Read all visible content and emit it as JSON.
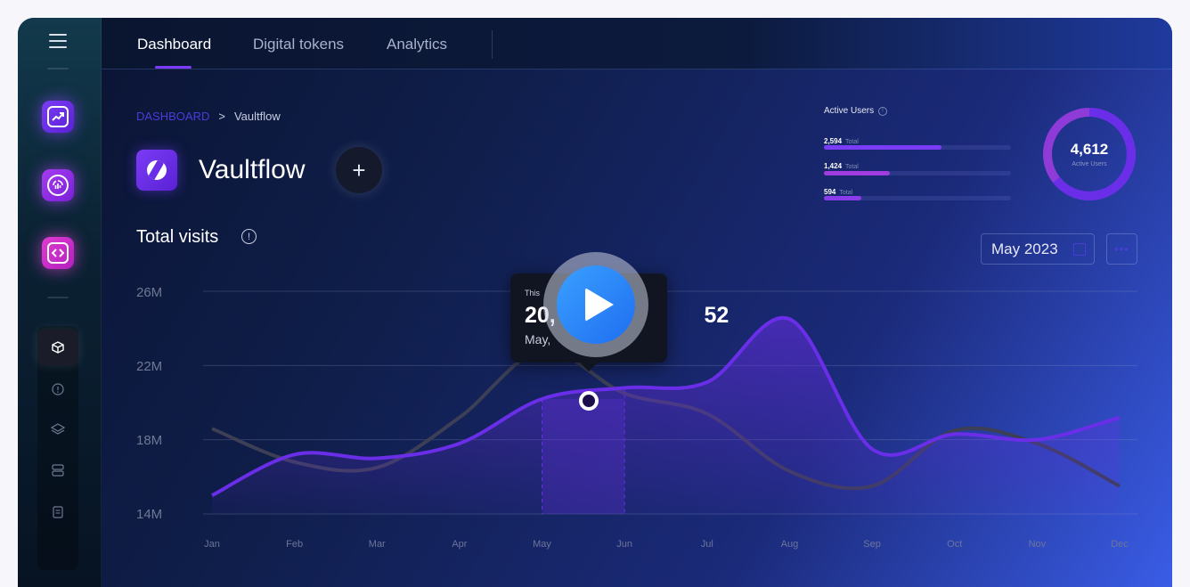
{
  "nav": {
    "tabs": [
      {
        "label": "Dashboard",
        "active": true
      },
      {
        "label": "Digital tokens",
        "active": false
      },
      {
        "label": "Analytics",
        "active": false
      }
    ]
  },
  "sidebar": {
    "apps": [
      {
        "name": "chart-app",
        "color": "#6a2ee8"
      },
      {
        "name": "fingerprint-app",
        "color": "#9c2ee8"
      },
      {
        "name": "code-app",
        "color": "#d42ed0"
      }
    ],
    "sub_items": [
      "cube",
      "alert",
      "layers",
      "server",
      "document"
    ]
  },
  "breadcrumb": {
    "root": "DASHBOARD",
    "separator": ">",
    "current": "Vaultflow"
  },
  "project": {
    "title": "Vaultflow",
    "add_label": "+"
  },
  "active_users": {
    "title": "Active Users",
    "rows": [
      {
        "value": "2,594",
        "label": "Total",
        "fraction": 0.63,
        "color": "#7b3cf7"
      },
      {
        "value": "1,424",
        "label": "Total",
        "fraction": 0.35,
        "color": "#a03ce0"
      },
      {
        "value": "594",
        "label": "Total",
        "fraction": 0.2,
        "color": "#8a3ce8"
      }
    ],
    "total": "4,612",
    "total_label": "Active Users"
  },
  "visits": {
    "title": "Total visits",
    "date_filter": "May 2023",
    "more_label": "•••"
  },
  "tooltip": {
    "label": "This",
    "value": "20,                        52",
    "date": "May,"
  },
  "chart_data": {
    "type": "line",
    "categories": [
      "Jan",
      "Feb",
      "Mar",
      "Apr",
      "May",
      "Jun",
      "Jul",
      "Aug",
      "Sep",
      "Oct",
      "Nov",
      "Dec"
    ],
    "y_ticks": [
      "26M",
      "22M",
      "18M",
      "14M"
    ],
    "ylim": [
      14,
      26
    ],
    "series": [
      {
        "values": [
          15.0,
          17.2,
          17.0,
          17.8,
          20.2,
          20.8,
          21.1,
          24.5,
          17.5,
          18.3,
          18.0,
          19.2
        ],
        "color": "#6a2ee8"
      },
      {
        "values": [
          18.6,
          16.8,
          16.5,
          19.2,
          22.8,
          20.5,
          19.4,
          16.3,
          15.5,
          18.5,
          17.8,
          15.5
        ],
        "color": "#3c3f55"
      }
    ],
    "highlight_range": [
      "May",
      "Jun"
    ],
    "grid": true
  }
}
